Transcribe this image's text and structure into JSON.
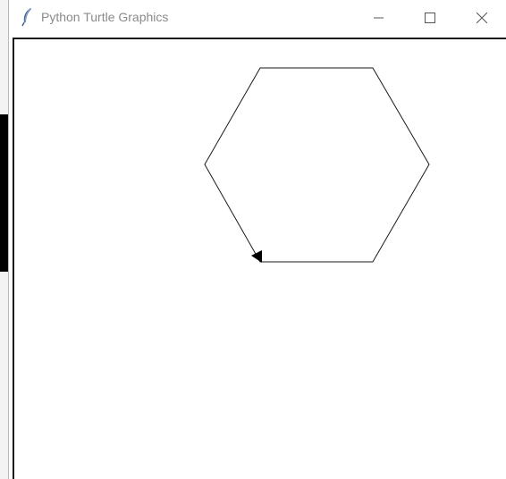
{
  "window": {
    "title": "Python Turtle Graphics",
    "icon": "feather-icon",
    "controls": {
      "minimize_icon": "minimize-icon",
      "maximize_icon": "maximize-icon",
      "close_icon": "close-icon"
    }
  },
  "canvas": {
    "background": "#ffffff",
    "line_color": "#1a1a1a",
    "shape": "hexagon",
    "turtle_icon": "turtle-arrow-icon"
  }
}
